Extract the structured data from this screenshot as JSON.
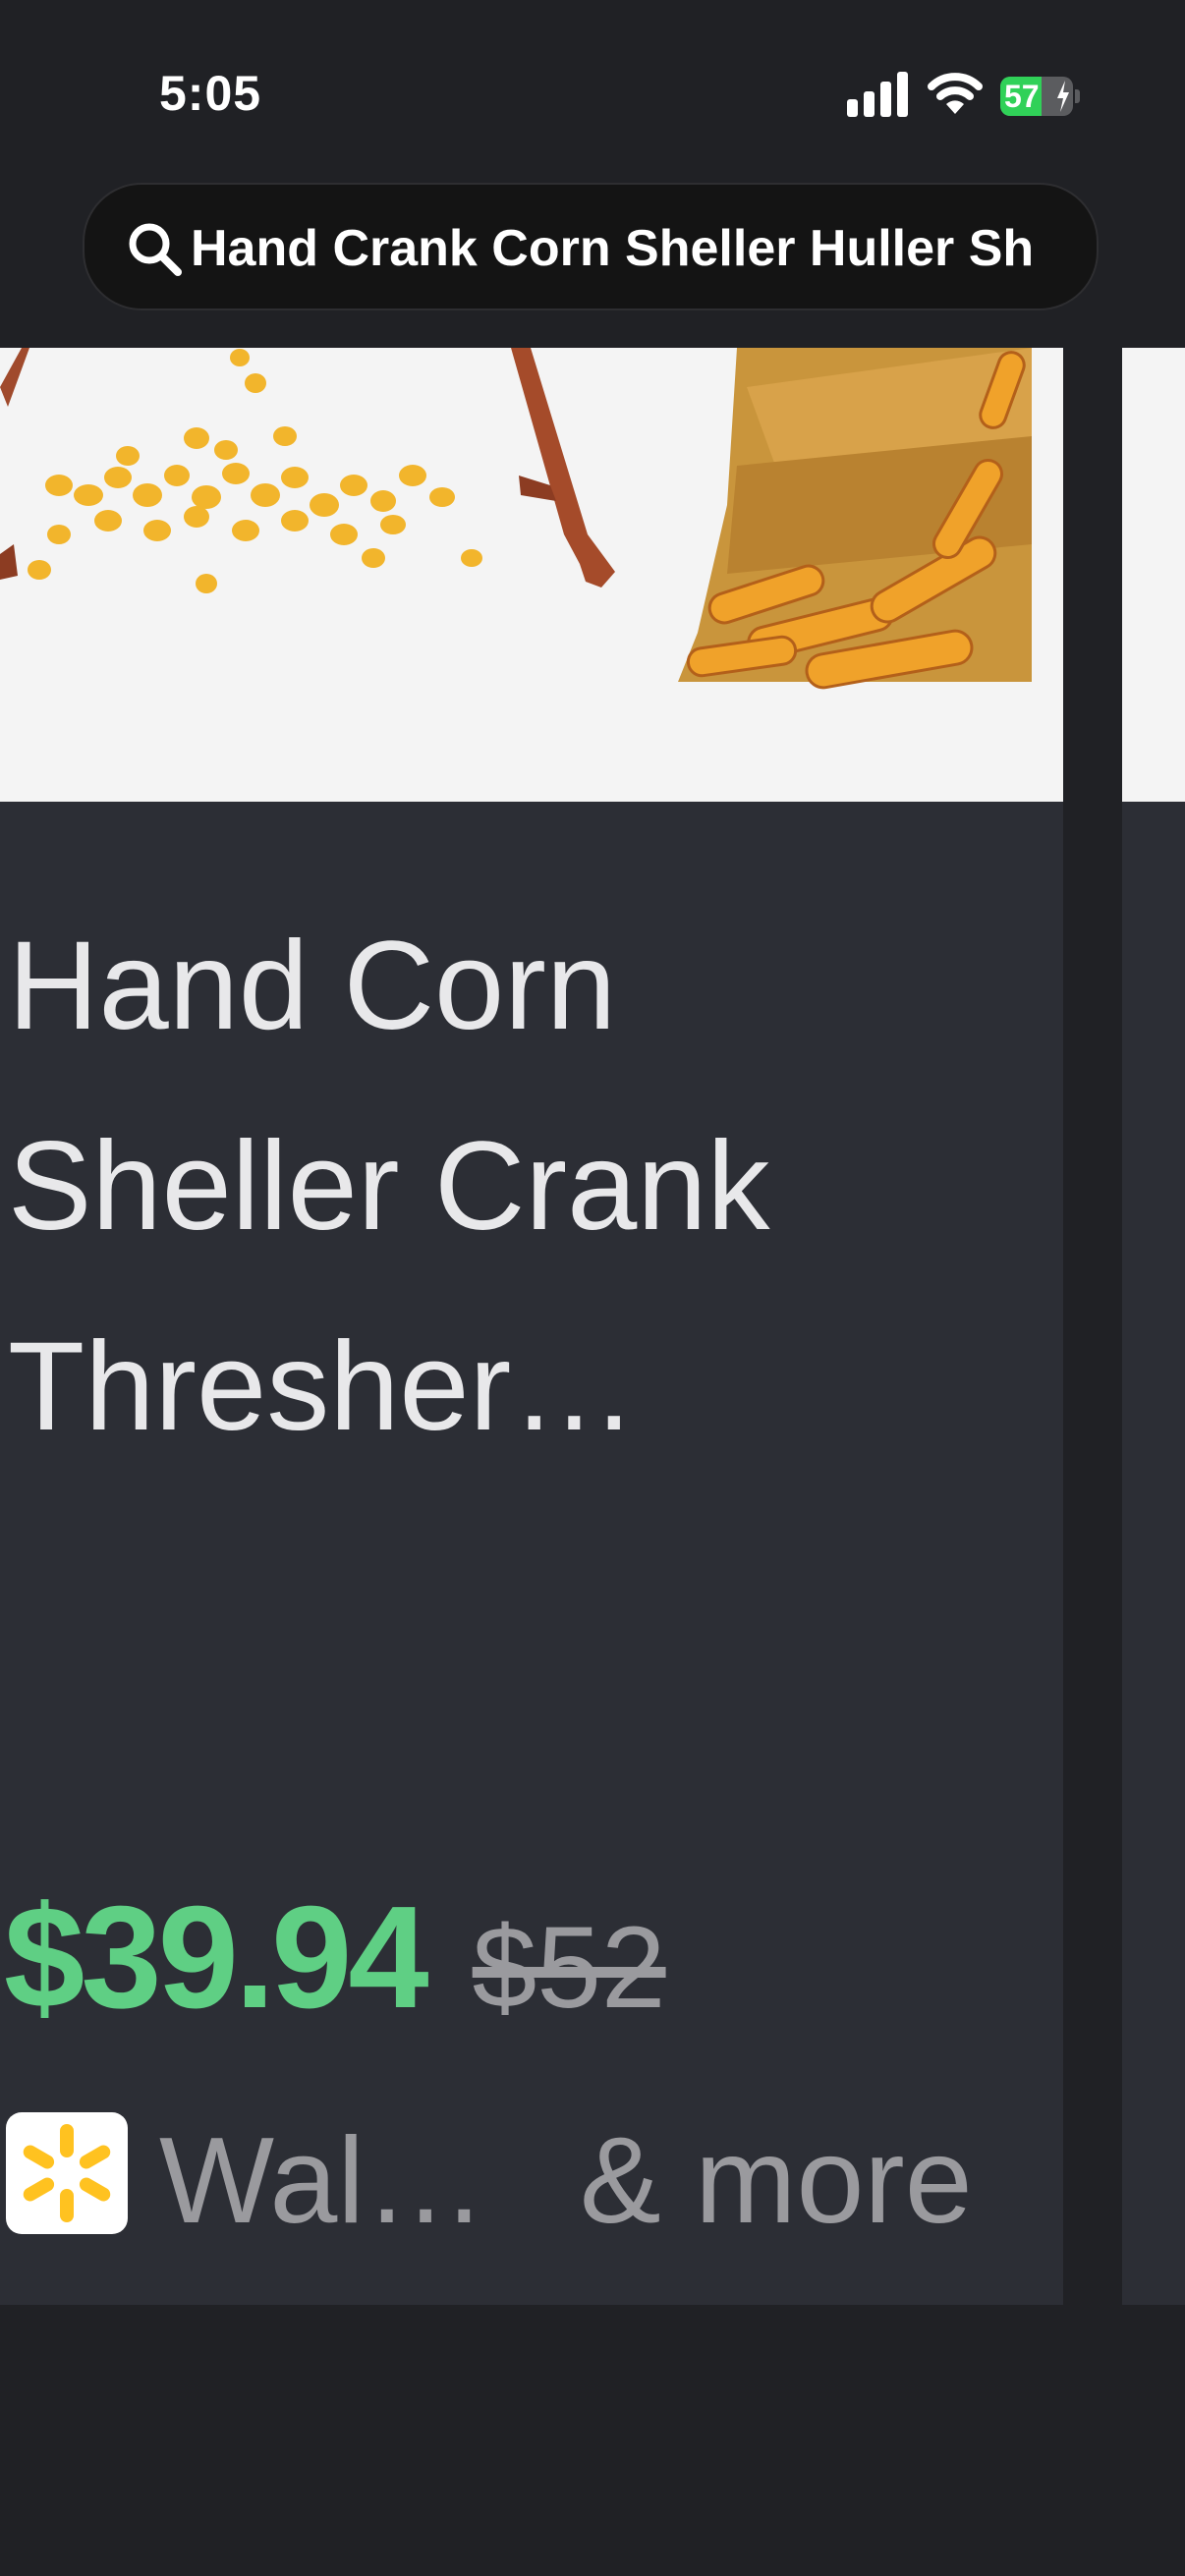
{
  "status_bar": {
    "time": "5:05",
    "battery_level": "57",
    "battery_fraction": 0.57,
    "battery_charging": true,
    "icons": [
      "cellular-signal-icon",
      "wifi-icon",
      "battery-icon"
    ]
  },
  "search": {
    "query": "Hand Crank Corn Sheller Huller Sh",
    "icon": "search-icon"
  },
  "product": {
    "title": "Hand Corn Sheller Crank Thresher…",
    "price": "$39.94",
    "original_price": "$52",
    "seller_name": "Wal…",
    "more_sellers": "& more",
    "seller_logo": "walmart-spark-logo"
  },
  "colors": {
    "background": "#202125",
    "card": "#2c2e35",
    "price_green": "#5fcf84",
    "muted_text": "#9a9a9e",
    "walmart_yellow": "#ffc220",
    "battery_green": "#30d158"
  }
}
